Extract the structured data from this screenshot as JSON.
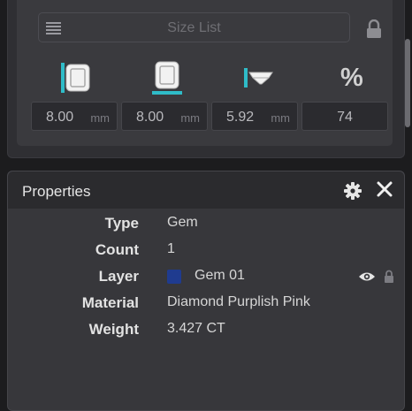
{
  "size_list": {
    "label": "Size List"
  },
  "dimensions": [
    {
      "icon": "gem-width-icon",
      "value": "8.00",
      "unit": "mm"
    },
    {
      "icon": "gem-length-icon",
      "value": "8.00",
      "unit": "mm"
    },
    {
      "icon": "gem-height-icon",
      "value": "5.92",
      "unit": "mm"
    },
    {
      "icon": "percent-icon",
      "symbol": "%",
      "value": "74",
      "unit": ""
    }
  ],
  "properties": {
    "title": "Properties",
    "rows": [
      {
        "key": "Type",
        "value": "Gem"
      },
      {
        "key": "Count",
        "value": "1"
      },
      {
        "key": "Layer",
        "value": "Gem 01"
      },
      {
        "key": "Material",
        "value": "Diamond Purplish Pink"
      },
      {
        "key": "Weight",
        "value": "3.427 CT"
      }
    ]
  },
  "colors": {
    "accent": "#2fbcc8",
    "layer_swatch": "#1f3b8f",
    "panel": "#37373b",
    "header": "#2b2b2e"
  }
}
